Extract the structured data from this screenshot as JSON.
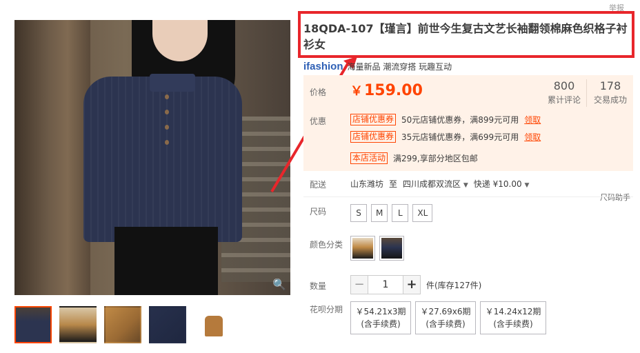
{
  "report_link": "举报",
  "title": "18QDA-107【瑾言】前世今生复古文艺长袖翻领棉麻色织格子衬衫女",
  "brand": {
    "logo_text": "ifashion",
    "tags": "海量新品 潮流穿搭 玩趣互动"
  },
  "price": {
    "label": "价格",
    "currency": "￥",
    "value": "159.00",
    "reviews_num": "800",
    "reviews_label": "累计评论",
    "sales_num": "178",
    "sales_label": "交易成功"
  },
  "promo": {
    "label": "优惠",
    "items": [
      {
        "tag": "店铺优惠券",
        "text": "50元店铺优惠券，满899元可用",
        "action": "领取"
      },
      {
        "tag": "店铺优惠券",
        "text": "35元店铺优惠券，满699元可用",
        "action": "领取"
      },
      {
        "tag": "本店活动",
        "text": "满299,享部分地区包邮",
        "action": ""
      }
    ]
  },
  "shipping": {
    "label": "配送",
    "from": "山东潍坊",
    "to_word": "至",
    "dest": "四川成都双流区",
    "method": "快递 ¥10.00"
  },
  "size_helper": "尺码助手",
  "size": {
    "label": "尺码",
    "options": [
      "S",
      "M",
      "L",
      "XL"
    ]
  },
  "color": {
    "label": "颜色分类"
  },
  "quantity": {
    "label": "数量",
    "minus": "−",
    "value": "1",
    "plus": "+",
    "stock": "件(库存127件)"
  },
  "installment": {
    "label": "花呗分期",
    "options": [
      {
        "amount": "￥54.21x3期",
        "fee": "(含手续费)"
      },
      {
        "amount": "￥27.69x6期",
        "fee": "(含手续费)"
      },
      {
        "amount": "￥14.24x12期",
        "fee": "(含手续费)"
      }
    ]
  },
  "zoom_icon": "🔍",
  "colors": {
    "price": "#ff4400",
    "highlight_box": "#e8262b",
    "price_bg": "#fff2e8"
  }
}
